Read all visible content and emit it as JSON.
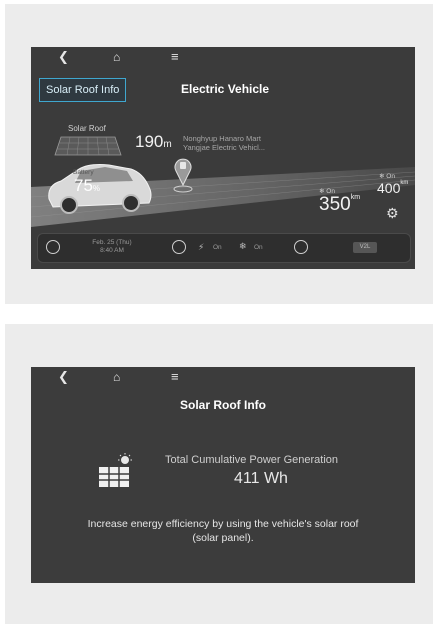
{
  "top_screen": {
    "nav": {
      "back_icon": "chevron-left-icon",
      "home_icon": "home-icon",
      "menu_icon": "menu-icon"
    },
    "solar_button_label": "Solar Roof Info",
    "title": "Electric Vehicle",
    "solar_roof_label": "Solar Roof",
    "battery": {
      "label": "Battery",
      "value": "75",
      "unit": "%"
    },
    "distance": {
      "value": "190",
      "unit": "m"
    },
    "station": {
      "line1": "Nonghyup Hanaro Mart",
      "line2": "Yangjae Electric Vehicl..."
    },
    "range_on": {
      "label": "On",
      "value": "350",
      "unit": "km"
    },
    "range_off": {
      "label": "On",
      "value": "400",
      "unit": "km"
    },
    "bottom_bar": {
      "date": "Feb. 25 (Thu)",
      "time": "8:40 AM",
      "charge_status": "On",
      "climate_status": "On",
      "v2l_label": "V2L"
    }
  },
  "bottom_screen": {
    "nav": {
      "back_icon": "chevron-left-icon",
      "home_icon": "home-icon",
      "menu_icon": "menu-icon"
    },
    "title": "Solar Roof Info",
    "generation_label": "Total Cumulative Power Generation",
    "generation_value": "411 Wh",
    "description_line1": "Increase energy efficiency by using the vehicle's solar roof",
    "description_line2": "(solar panel).",
    "icon": "solar-panel-icon"
  },
  "colors": {
    "screen_bg": "#3b3b3b",
    "accent": "#3fa7cf",
    "panel_bg": "#ececec"
  }
}
